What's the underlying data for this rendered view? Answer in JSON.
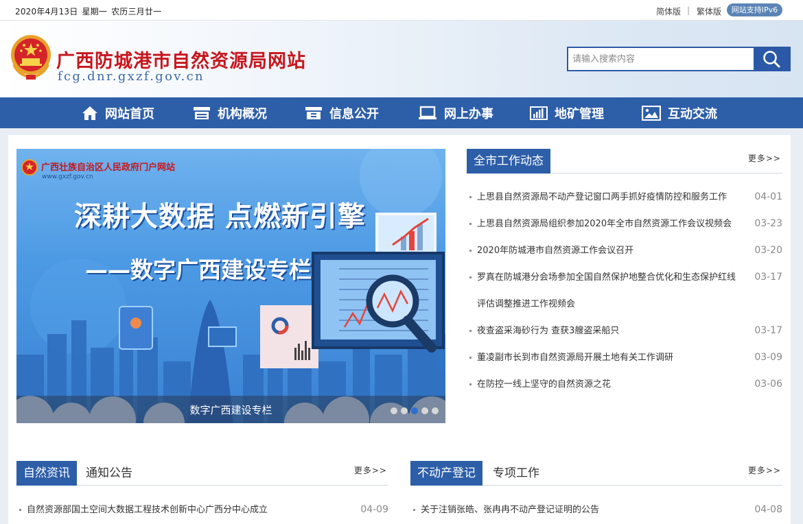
{
  "topbar": {
    "date": "2020年4月13日",
    "weekday": "星期一",
    "lunar": "农历三月廿一",
    "simplified": "简体版",
    "separator": "|",
    "traditional": "繁体版",
    "ipv6": "网站支持IPv6"
  },
  "header": {
    "title": "广西防城港市自然资源局网站",
    "domain": "fcg.dnr.gxzf.gov.cn",
    "search_placeholder": "请输入搜索内容"
  },
  "nav": [
    {
      "label": "网站首页",
      "icon": "home-icon"
    },
    {
      "label": "机构概况",
      "icon": "building-icon"
    },
    {
      "label": "信息公开",
      "icon": "cabinet-icon"
    },
    {
      "label": "网上办事",
      "icon": "laptop-icon"
    },
    {
      "label": "地矿管理",
      "icon": "bar-chart-icon"
    },
    {
      "label": "互动交流",
      "icon": "image-icon"
    }
  ],
  "banner": {
    "portal": "广西壮族自治区人民政府门户网站",
    "portal_url": "www.gxzf.gov.cn",
    "headline": "深耕大数据 点燃新引擎",
    "subline": "——数字广西建设专栏",
    "caption": "数字广西建设专栏",
    "slide_count": 5,
    "active_slide": 3
  },
  "city_news": {
    "title": "全市工作动态",
    "more": "更多>>",
    "items": [
      {
        "title": "上思县自然资源局不动产登记窗口两手抓好疫情防控和服务工作",
        "date": "04-01"
      },
      {
        "title": "上思县自然资源局组织参加2020年全市自然资源工作会议视频会",
        "date": "03-23"
      },
      {
        "title": "2020年防城港市自然资源工作会议召开",
        "date": "03-20"
      },
      {
        "title": "罗真在防城港分会场参加全国自然保护地整合优化和生态保护红线评估调整推进工作视频会",
        "date": "03-17"
      },
      {
        "title": "夜查盗采海砂行为 查获3艘盗采船只",
        "date": "03-17"
      },
      {
        "title": "董凌副市长到市自然资源局开展土地有关工作调研",
        "date": "03-09"
      },
      {
        "title": "在防控一线上坚守的自然资源之花",
        "date": "03-06"
      }
    ]
  },
  "nature_news": {
    "tab_active": "自然资讯",
    "tab_other": "通知公告",
    "more": "更多>>",
    "items": [
      {
        "title": "自然资源部国土空间大数据工程技术创新中心广西分中心成立",
        "date": "04-09"
      }
    ]
  },
  "estate": {
    "tab_active": "不动产登记",
    "tab_other": "专项工作",
    "more": "更多>>",
    "items": [
      {
        "title": "关于注销张皓、张冉冉不动产登记证明的公告",
        "date": "04-08"
      }
    ]
  },
  "colors": {
    "nav_blue": "#2d5ea8",
    "title_red": "#c8161d",
    "domain_blue": "#3b6aa6"
  }
}
